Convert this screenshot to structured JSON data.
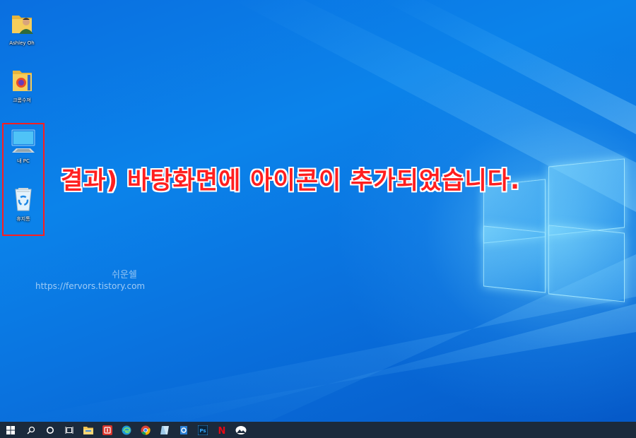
{
  "desktop": {
    "icons": [
      {
        "label": "Ashley Oh",
        "icon": "user-folder-icon"
      },
      {
        "label": "크롬수져",
        "icon": "folder-icon"
      },
      {
        "label": "내 PC",
        "icon": "this-pc-icon"
      },
      {
        "label": "휴지통",
        "icon": "recycle-bin-icon"
      }
    ],
    "annotation": "결과) 바탕화면에 아이콘이 추가되었습니다.",
    "watermark_title": "쉬운쉘",
    "watermark_url": "https://fervors.tistory.com"
  },
  "taskbar": {
    "items": [
      {
        "icon": "windows-start-icon"
      },
      {
        "icon": "search-icon"
      },
      {
        "icon": "cortana-icon"
      },
      {
        "icon": "task-view-icon"
      },
      {
        "icon": "file-explorer-icon"
      },
      {
        "icon": "app-red-icon"
      },
      {
        "icon": "edge-icon"
      },
      {
        "icon": "chrome-icon"
      },
      {
        "icon": "notepad-icon"
      },
      {
        "icon": "settings-app-icon"
      },
      {
        "icon": "photoshop-icon",
        "text": "Ps"
      },
      {
        "icon": "netflix-icon",
        "text": "N"
      },
      {
        "icon": "photos-icon"
      }
    ]
  },
  "colors": {
    "annotation_red": "#ff1f1f",
    "selection_red": "#ff1e1e",
    "taskbar_bg": "#1b2a3c",
    "desktop_blue": "#0b83ea"
  }
}
